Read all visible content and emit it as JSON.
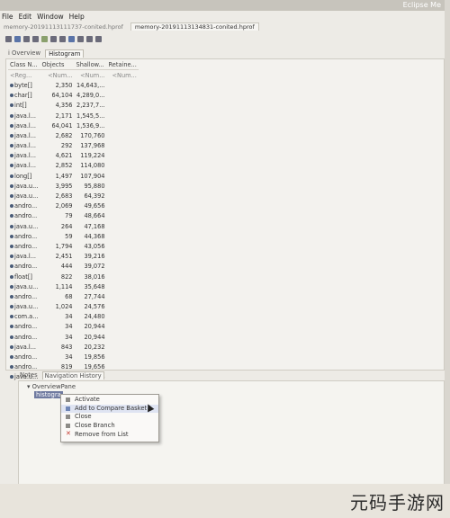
{
  "titlebar": {
    "right_text": "Eclipse Me"
  },
  "menu": [
    "File",
    "Edit",
    "Window",
    "Help"
  ],
  "editor_tabs": [
    {
      "label": "memory-20191113111737-conited.hprof",
      "active": false
    },
    {
      "label": "memory-20191113134831-conited.hprof",
      "active": true
    }
  ],
  "pane_tabs": [
    {
      "label": "i  Overview",
      "active": false
    },
    {
      "label": "Histogram",
      "active": true
    }
  ],
  "histogram": {
    "headers": [
      "Class N...",
      "Objects",
      "Shallow...",
      "Retaine..."
    ],
    "regex_row": [
      "<Reg...",
      "<Num...",
      "<Num...",
      "<Num..."
    ],
    "rows": [
      [
        "byte[]",
        "2,350",
        "14,643,...",
        ""
      ],
      [
        "char[]",
        "64,104",
        "4,289,0...",
        ""
      ],
      [
        "int[]",
        "4,356",
        "2,237,7...",
        ""
      ],
      [
        "java.l...",
        "2,171",
        "1,545,5...",
        ""
      ],
      [
        "java.l...",
        "64,041",
        "1,536,9...",
        ""
      ],
      [
        "java.l...",
        "2,682",
        "170,760",
        ""
      ],
      [
        "java.l...",
        "292",
        "137,968",
        ""
      ],
      [
        "java.l...",
        "4,621",
        "119,224",
        ""
      ],
      [
        "java.l...",
        "2,852",
        "114,080",
        ""
      ],
      [
        "long[]",
        "1,497",
        "107,904",
        ""
      ],
      [
        "java.u...",
        "3,995",
        "95,880",
        ""
      ],
      [
        "java.u...",
        "2,683",
        "64,392",
        ""
      ],
      [
        "andro...",
        "2,069",
        "49,656",
        ""
      ],
      [
        "andro...",
        "79",
        "48,664",
        ""
      ],
      [
        "java.u...",
        "264",
        "47,168",
        ""
      ],
      [
        "andro...",
        "59",
        "44,368",
        ""
      ],
      [
        "andro...",
        "1,794",
        "43,056",
        ""
      ],
      [
        "java.l...",
        "2,451",
        "39,216",
        ""
      ],
      [
        "andro...",
        "444",
        "39,072",
        ""
      ],
      [
        "float[]",
        "822",
        "38,016",
        ""
      ],
      [
        "java.u...",
        "1,114",
        "35,648",
        ""
      ],
      [
        "andro...",
        "68",
        "27,744",
        ""
      ],
      [
        "java.u...",
        "1,024",
        "24,576",
        ""
      ],
      [
        "com.a...",
        "34",
        "24,480",
        ""
      ],
      [
        "andro...",
        "34",
        "20,944",
        ""
      ],
      [
        "andro...",
        "34",
        "20,944",
        ""
      ],
      [
        "java.l...",
        "843",
        "20,232",
        ""
      ],
      [
        "andro...",
        "34",
        "19,856",
        ""
      ],
      [
        "andro...",
        "819",
        "19,656",
        ""
      ],
      [
        "java.u...",
        "614",
        "19,648",
        ""
      ]
    ]
  },
  "bottom_tabs": [
    {
      "label": "Notes",
      "active": false
    },
    {
      "label": "Navigation History",
      "active": true
    }
  ],
  "tree": {
    "root": "OverviewPane",
    "child": "histogra"
  },
  "context_menu": [
    {
      "label": "Activate",
      "icon": "activate-icon"
    },
    {
      "label": "Add to Compare Basket",
      "icon": "compare-basket-icon",
      "hover": true
    },
    {
      "label": "Close",
      "icon": "close-icon"
    },
    {
      "label": "Close Branch",
      "icon": "close-branch-icon"
    },
    {
      "label": "Remove from List",
      "icon": "remove-icon"
    }
  ],
  "watermark": "元码手游网"
}
